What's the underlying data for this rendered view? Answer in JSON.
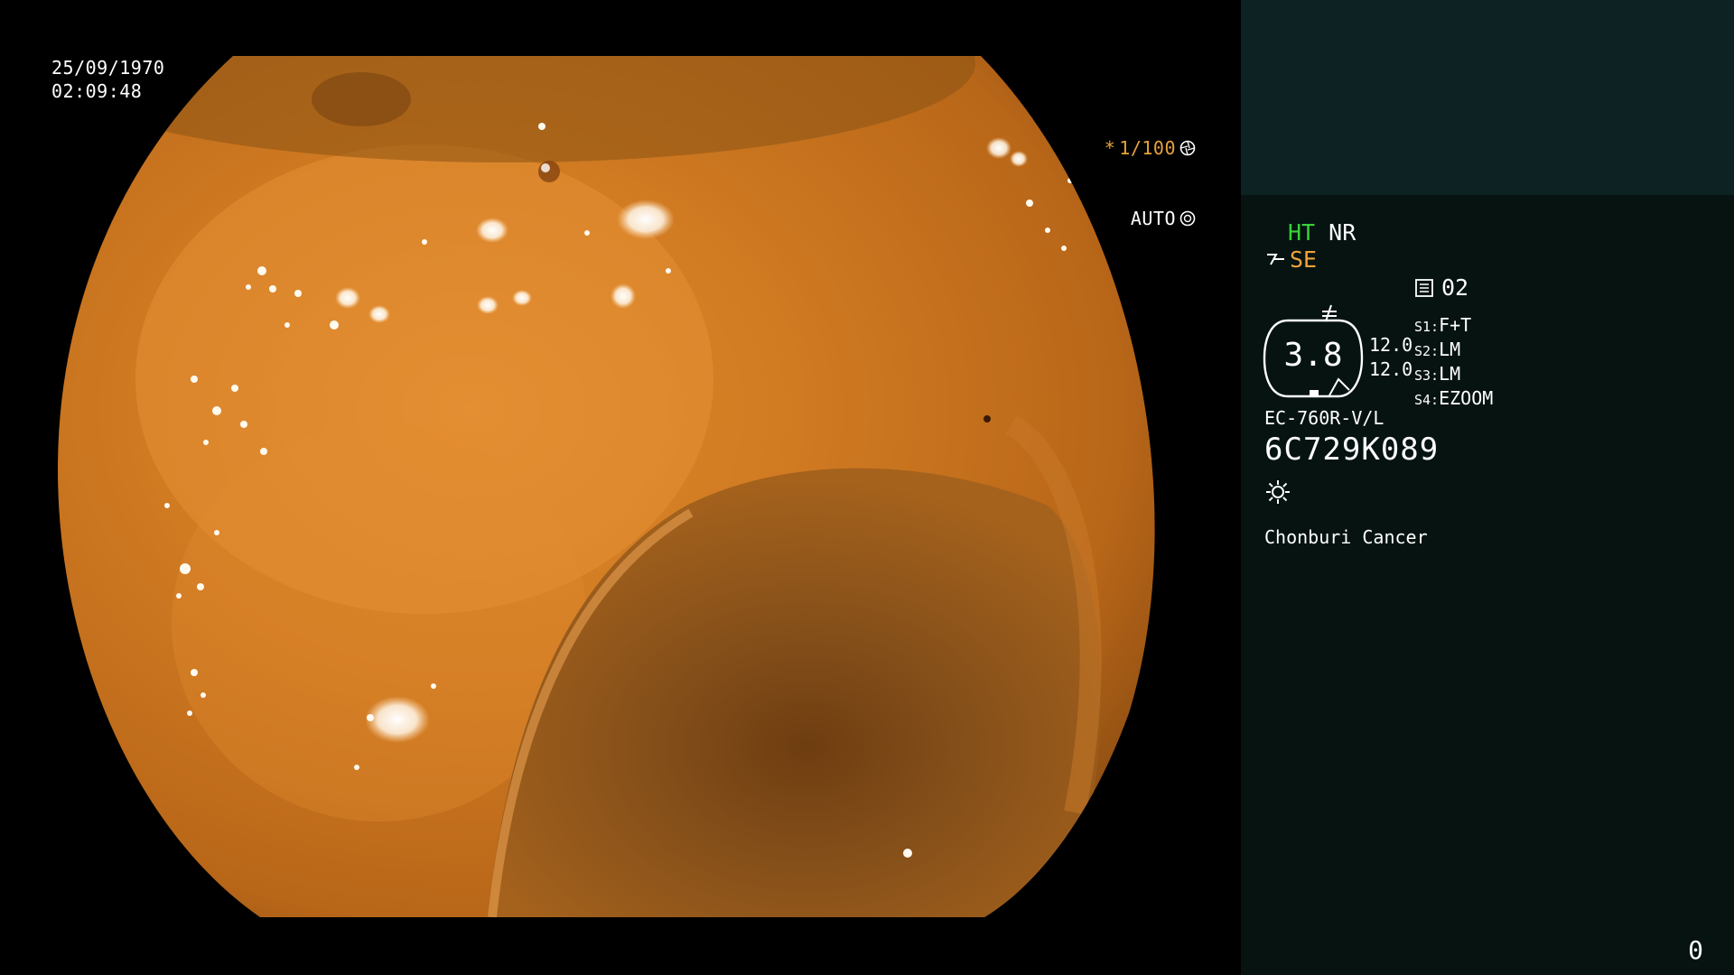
{
  "overlay": {
    "date": "25/09/1970",
    "time": "02:09:48",
    "shutter_prefix": "*",
    "shutter": "1/100",
    "iris_mode": "AUTO"
  },
  "panel": {
    "mode_ht": "HT",
    "mode_nr": "NR",
    "enhance": "SE",
    "record_number": "02",
    "zoom_value": "3.8",
    "zoom_side": [
      "12.0",
      "12.0"
    ],
    "switches": [
      {
        "label": "S1:",
        "value": "F+T"
      },
      {
        "label": "S2:",
        "value": "LM"
      },
      {
        "label": "S3:",
        "value": "LM"
      },
      {
        "label": "S4:",
        "value": "EZOOM"
      }
    ],
    "scope_model": "EC-760R-V/L",
    "scope_serial": "6C729K089",
    "hospital": "Chonburi Cancer",
    "counter": "0"
  },
  "colors": {
    "panel_bg": "#061311",
    "thumb_bg": "#0d2223",
    "accent_green": "#39d13a",
    "accent_orange": "#f2a43a"
  },
  "icons": [
    "shutter-icon",
    "iris-icon",
    "enhance-icon",
    "structure-icon",
    "record-icon",
    "light-icon"
  ]
}
